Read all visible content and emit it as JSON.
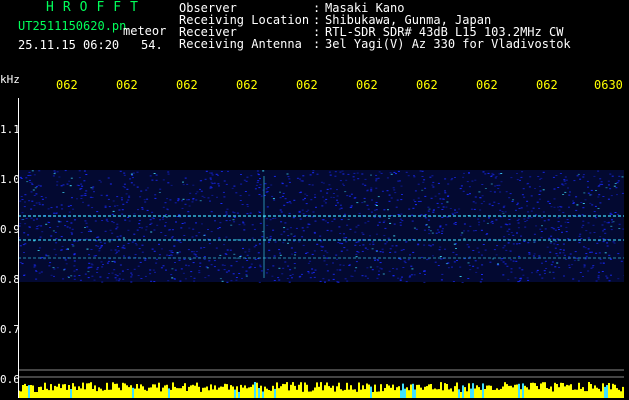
{
  "header": {
    "brand": "HROFFT",
    "filename": "UT2511150620.pn",
    "meteor_label": "meteor",
    "datetime": "25.11.15 06:20",
    "count": "54."
  },
  "info": [
    {
      "label": "Observer",
      "sep": ":",
      "value": "Masaki Kano"
    },
    {
      "label": "Receiving Location",
      "sep": ":",
      "value": "Shibukawa, Gunma, Japan"
    },
    {
      "label": "Receiver",
      "sep": ":",
      "value": "RTL-SDR SDR# 43dB L15 103.2MHz CW"
    },
    {
      "label": "Receiving Antenna",
      "sep": ":",
      "value": "3el Yagi(V) Az 330 for Vladivostok"
    }
  ],
  "axis": {
    "unit_label": "kHz",
    "x_ticks": [
      "062",
      "062",
      "062",
      "062",
      "062",
      "062",
      "062",
      "062",
      "062",
      "0630"
    ],
    "y_ticks": [
      "1.1",
      "1.0",
      "0.9",
      "0.8",
      "0.7",
      "0.6"
    ]
  },
  "colors": {
    "label_green": "#00ff5a",
    "label_white": "#ffffff",
    "tick_yellow": "#ffff00",
    "noise_blue": "#1a2aff",
    "echo_cyan": "#40e0ff",
    "baseline_yellow": "#ffff00"
  }
}
